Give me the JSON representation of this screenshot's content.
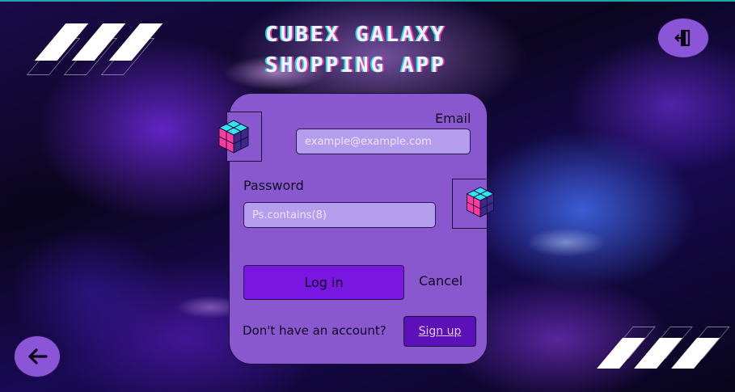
{
  "app": {
    "title_line1": "Cubex Galaxy",
    "title_line2": "Shopping App"
  },
  "header": {
    "logout_icon": "logout-icon",
    "back_icon": "arrow-left-icon"
  },
  "login_form": {
    "email_label": "Email",
    "email_placeholder": "example@example.com",
    "email_value": "",
    "password_label": "Password",
    "password_placeholder": "Ps.contains(8)",
    "password_value": "",
    "login_button": "Log in",
    "cancel_button": "Cancel",
    "no_account_text": "Don't have an account?",
    "signup_button": "Sign up",
    "cube_icon": "rubiks-cube-icon"
  },
  "colors": {
    "card": "#8958cf",
    "field": "#b59dee",
    "login_button": "#7a16e2",
    "signup_button": "#5c10b8",
    "circle_button": "#8b55d8"
  }
}
